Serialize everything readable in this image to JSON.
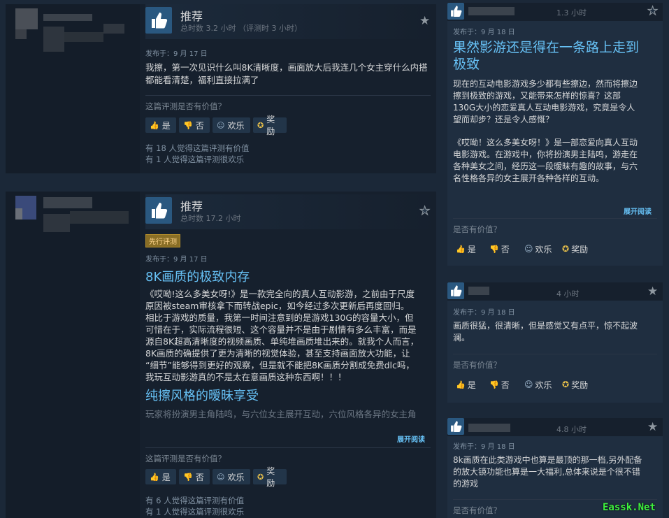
{
  "reviews": [
    {
      "verdict": "推荐",
      "hours": "总时数 3.2 小时 （评测时 3 小时）",
      "posted": "发布于：9 月 17 日",
      "text": "我擦，第一次见识什么叫8K清晰度，画面放大后我连几个女主穿什么内搭都能看清楚，福利直接拉满了",
      "helpful_question": "这篇评测是否有价值？",
      "buttons": {
        "yes": "是",
        "no": "否",
        "funny": "欢乐",
        "award": "奖励"
      },
      "stats": [
        "有 18 人觉得这篇评测有价值",
        "有 1 人觉得这篇评测很欢乐"
      ]
    },
    {
      "verdict": "推荐",
      "hours": "总时数 17.2 小时",
      "badge": "先行评测",
      "posted": "发布于：9 月 17 日",
      "heading1": "8K画质的极致内存",
      "paragraph": [
        "《哎呦!这么多美女呀!》是一款完全向的真人互动影游，之前由于尺度",
        "原因被steam审核拿下而转战epic，如今经过多次更新后再度回归。",
        "相比于游戏的质量，我第一时间注意到的是游戏130G的容量大小，但",
        "可惜在于，实际流程很短、这个容量并不是由于剧情有多么丰富，而是",
        "源自8K超高清晰度的视频画质、单纯堆画质堆出来的。就我个人而言，",
        "8K画质的确提供了更为清晰的视觉体验，甚至支持画面放大功能，让",
        "“细节”能够得到更好的观察，但是就不能把8K画质分割成免费dlc吗，",
        "我玩互动影游真的不是太在意画质这种东西啊！！！"
      ],
      "heading2": "纯擦风格的暧昧享受",
      "fade_text": "玩家将扮演男主角陆鸣，与六位女主展开互动，六位风格各异的女主角",
      "expand": "展开阅读",
      "helpful_question": "这篇评测是否有价值？",
      "buttons": {
        "yes": "是",
        "no": "否",
        "funny": "欢乐",
        "award": "奖励"
      },
      "stats": [
        "有 6 人觉得这篇评测有价值",
        "有 1 人觉得这篇评测很欢乐"
      ]
    }
  ],
  "side_reviews": [
    {
      "hours": "1.3 小时",
      "posted": "发布于：9 月 18 日",
      "title_lines": [
        "果然影游还是得在一条路上走到",
        "极致"
      ],
      "para1": [
        "现在的互动电影游戏多少都有些擦边，然而将擦边",
        "擦到极致的游戏，又能带来怎样的惊喜？这部",
        "130G大小的恋爱真人互动电影游戏，究竟是令人",
        "望而却步？还是令人感慨？"
      ],
      "para2": [
        "《哎呦！这么多美女呀！》是一部恋爱向真人互动",
        "电影游戏。在游戏中，你将扮演男主陆鸣，游走在",
        "各种美女之间，经历这一段暧昧有趣的故事，与六",
        "名性格各异的女主展开各种各样的互动。"
      ],
      "expand": "展开阅读",
      "helpful_question": "是否有价值？",
      "buttons": {
        "yes": "是",
        "no": "否",
        "funny": "欢乐",
        "award": "奖励"
      }
    },
    {
      "hours": "4 小时",
      "posted": "发布于：9 月 18 日",
      "text_lines": [
        "画质很猛，很清晰，但是感觉又有点平，惊不起波",
        "澜。"
      ],
      "helpful_question": "是否有价值？",
      "buttons": {
        "yes": "是",
        "no": "否",
        "funny": "欢乐",
        "award": "奖励"
      }
    },
    {
      "hours": "4.8 小时",
      "posted": "发布于：9 月 18 日",
      "text_lines": [
        "8k画质在此类游戏中也算是最顶的那一档,另外配备",
        "的放大镜功能也算是一大福利,总体来说是个很不错",
        "的游戏"
      ],
      "helpful_question": "是否有价值？"
    }
  ],
  "watermark": "Eassk.Net",
  "colors": {
    "background": "#1b2838",
    "accent": "#66c0f4",
    "badge": "#896e26"
  }
}
